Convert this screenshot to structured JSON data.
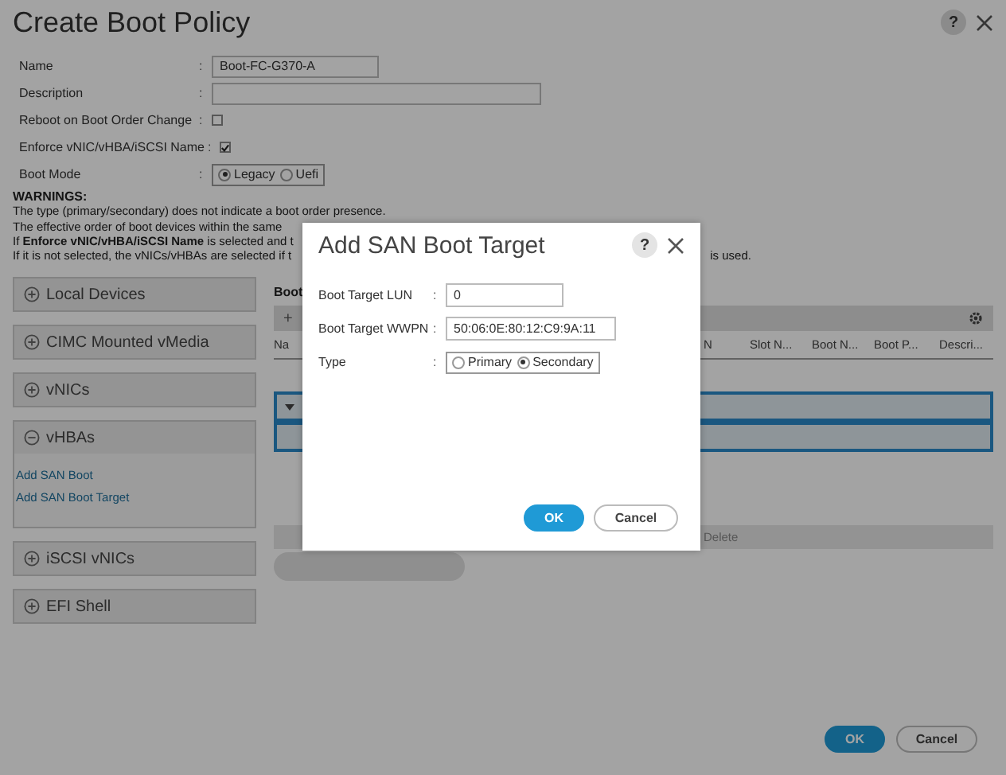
{
  "window": {
    "title": "Create Boot Policy",
    "help": "?"
  },
  "form": [
    {
      "kind": "text",
      "label": "Name",
      "colon": ":",
      "value": "Boot-FC-G370-A"
    },
    {
      "kind": "text",
      "label": "Description",
      "colon": ":"
    },
    {
      "kind": "check",
      "label": "Reboot on Boot Order Change",
      "colon": ":",
      "checked": false
    },
    {
      "kind": "check",
      "label": "Enforce vNIC/vHBA/iSCSI Name",
      "colon": ":",
      "checked": true
    },
    {
      "kind": "radio",
      "label": "Boot Mode",
      "colon": ":",
      "options": [
        {
          "label": "Legacy",
          "selected": true
        },
        {
          "label": "Uefi",
          "selected": false
        }
      ]
    }
  ],
  "warnings": {
    "heading": "WARNINGS:",
    "lines": [
      {
        "left": "The type (primary/secondary) does not indicate a boot order presence."
      },
      {
        "left": "The effective order of boot devices within the same"
      },
      {
        "left": "If **Enforce vNIC/vHBA/iSCSI Name** is selected and t"
      },
      {
        "left": "If it is not selected, the vNICs/vHBAs are selected if t",
        "right": "is used."
      }
    ]
  },
  "sections": [
    {
      "label": "Local Devices",
      "expanded": false
    },
    {
      "label": "CIMC Mounted vMedia",
      "expanded": false
    },
    {
      "label": "vNICs",
      "expanded": false
    },
    {
      "label": "vHBAs",
      "expanded": true,
      "links": [
        "Add SAN Boot",
        "Add SAN Boot Target"
      ]
    },
    {
      "label": "iSCSI vNICs",
      "expanded": false
    },
    {
      "label": "EFI Shell",
      "expanded": false
    }
  ],
  "boot_order": {
    "heading": "Boot",
    "add": "+",
    "columns": [
      "Na",
      "N",
      "Slot N...",
      "Boot N...",
      "Boot P...",
      "Descri..."
    ],
    "rows": [
      {
        "selected": true
      },
      {
        "selected": true
      }
    ],
    "actions": [
      "Delete"
    ]
  },
  "buttons": [
    {
      "label": "OK",
      "kind": "primary"
    },
    {
      "label": "Cancel",
      "kind": "secondary"
    }
  ],
  "dialog": {
    "title": "Add SAN Boot Target",
    "help": "?",
    "fields": [
      {
        "kind": "text",
        "label": "Boot Target LUN",
        "colon": ":",
        "value": "0"
      },
      {
        "kind": "text",
        "label": "Boot Target WWPN",
        "colon": ":",
        "value": "50:06:0E:80:12:C9:9A:11"
      },
      {
        "kind": "radio",
        "label": "Type",
        "colon": ":",
        "options": [
          {
            "label": "Primary",
            "selected": false
          },
          {
            "label": "Secondary",
            "selected": true
          }
        ]
      }
    ],
    "buttons": [
      {
        "label": "OK",
        "kind": "primary"
      },
      {
        "label": "Cancel",
        "kind": "secondary"
      }
    ]
  }
}
